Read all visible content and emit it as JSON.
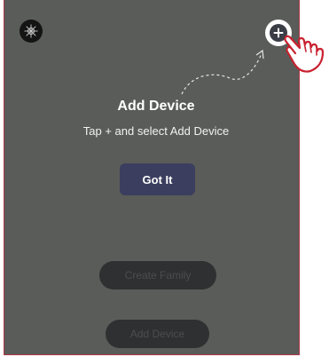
{
  "overlay": {
    "title": "Add Device",
    "subtitle": "Tap + and select Add Device",
    "got_it_label": "Got It"
  },
  "background_actions": {
    "create_family_label": "Create Family",
    "add_device_label": "Add Device"
  },
  "icons": {
    "avatar": "avatar-icon",
    "add": "plus-icon",
    "hand": "pointing-hand-icon",
    "arrow": "dashed-arrow-icon"
  },
  "colors": {
    "overlay_background": "#5a5c59",
    "primary_button": "#3b3e5e",
    "border": "#b03a48"
  }
}
